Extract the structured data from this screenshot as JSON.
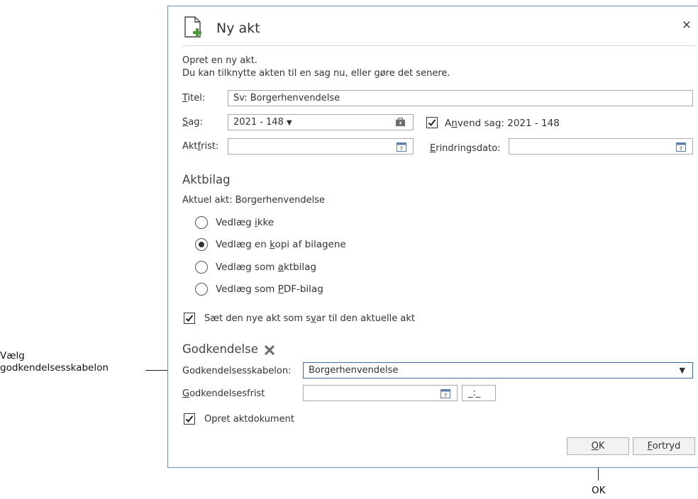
{
  "callouts": {
    "left_line1": "Vælg",
    "left_line2": "godkendelsesskabelon",
    "bottom": "OK"
  },
  "dialog": {
    "title": "Ny akt",
    "close": "×",
    "intro_line1": "Opret en ny akt.",
    "intro_line2": "Du kan tilknytte akten til en sag nu, eller gøre det senere.",
    "titel_label_u": "T",
    "titel_label_rest": "itel:",
    "titel_value": "Sv: Borgerhenvendelse",
    "sag_label_u": "S",
    "sag_label_rest": "ag:",
    "sag_value": "2021 - 148",
    "anvend_pre": "A",
    "anvend_u": "n",
    "anvend_rest": "vend sag: 2021 - 148",
    "aktfrist_pre": "Akt",
    "aktfrist_u": "f",
    "aktfrist_rest": "rist:",
    "erindring_u": "E",
    "erindring_rest": "rindringsdato:",
    "aktbilag_heading": "Aktbilag",
    "aktuel_akt": "Aktuel akt: Borgerhenvendelse",
    "options": [
      {
        "pre": "Vedlæg ",
        "u": "i",
        "rest": "kke",
        "selected": false
      },
      {
        "pre": "Vedlæg en ",
        "u": "k",
        "rest": "opi af bilagene",
        "selected": true
      },
      {
        "pre": "Vedlæg som ",
        "u": "a",
        "rest": "ktbilag",
        "selected": false
      },
      {
        "pre": "Vedlæg som ",
        "u": "P",
        "rest": "DF-bilag",
        "selected": false
      }
    ],
    "svar_pre": "Sæt den nye akt som s",
    "svar_u": "v",
    "svar_rest": "ar til den aktuelle akt",
    "godkendelse_heading": "Godkendelse",
    "skabelon_label": "Godkendelsesskabelon:",
    "skabelon_value": "Borgerhenvendelse",
    "frist_u": "G",
    "frist_rest": "odkendelsesfrist",
    "time_value": "_:_",
    "opret_label": "Opret aktdokument",
    "ok_u": "O",
    "ok_rest": "K",
    "cancel_u": "F",
    "cancel_rest": "ortryd"
  },
  "colors": {
    "accent_green": "#4a9a3c",
    "dialog_border": "#6f8fb3",
    "calendar_blue": "#5b7fa6"
  }
}
